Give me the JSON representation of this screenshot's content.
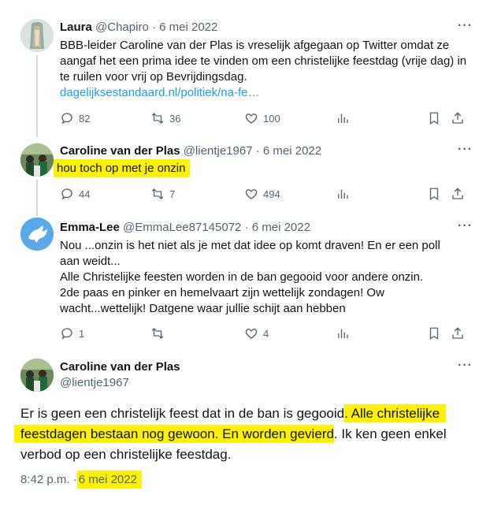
{
  "tweets": [
    {
      "name": "Laura",
      "handle": "@Chapiro",
      "dot": "·",
      "date": "6 mei 2022",
      "text": "BBB-leider Caroline van der Plas is vreselijk afgegaan op Twitter omdat ze aangaf het een prima idee te vinden om een christelijke feestdag (vrije dag) in te ruilen voor vrij op Bevrijdingsdag.",
      "link": "dagelijksestandaard.nl/politiek/na-fe…",
      "replies": "82",
      "retweets": "36",
      "likes": "100"
    },
    {
      "name": "Caroline van der Plas",
      "handle": "@lientje1967",
      "dot": "·",
      "date": "6 mei 2022",
      "text": "hou toch op met je onzin",
      "replies": "44",
      "retweets": "7",
      "likes": "494"
    },
    {
      "name": "Emma-Lee",
      "handle": "@EmmaLee87145072",
      "dot": "·",
      "date": "6 mei 2022",
      "lines": [
        "Nou ...onzin is het niet als je met dat  idee op komt draven! En er een poll",
        "aan weidt...",
        "Alle Christelijke feesten worden in de ban gegooid voor andere onzin.",
        "2de paas en pinker en hemelvaart zijn wettelijk zondagen! Ow",
        "wacht...wettelijk! Datgene waar jullie schijt aan hebben"
      ],
      "replies": "1",
      "retweets": "",
      "likes": "4"
    }
  ],
  "main": {
    "name": "Caroline van der Plas",
    "handle": "@lientje1967",
    "line1_plain": "Er is geen een christelijk feest dat in de ban is gegooid",
    "line1_hl": ". Alle christelijke",
    "line2_hl": "feestdagen bestaan nog gewoon. En worden gevierd",
    "line2_plain": ". Ik ken geen enkel",
    "line3": "verbod op een christelijke feestdag.",
    "time": "8:42 p.m.",
    "time_dot": "·",
    "date": "6 mei 2022"
  },
  "more_label": "···",
  "colors": {
    "accent": "#1d9bf0",
    "highlight": "#fff200",
    "muted": "#536471"
  },
  "icons": [
    "reply-icon",
    "retweet-icon",
    "like-icon",
    "views-icon",
    "bookmark-icon",
    "share-icon",
    "more-icon"
  ]
}
